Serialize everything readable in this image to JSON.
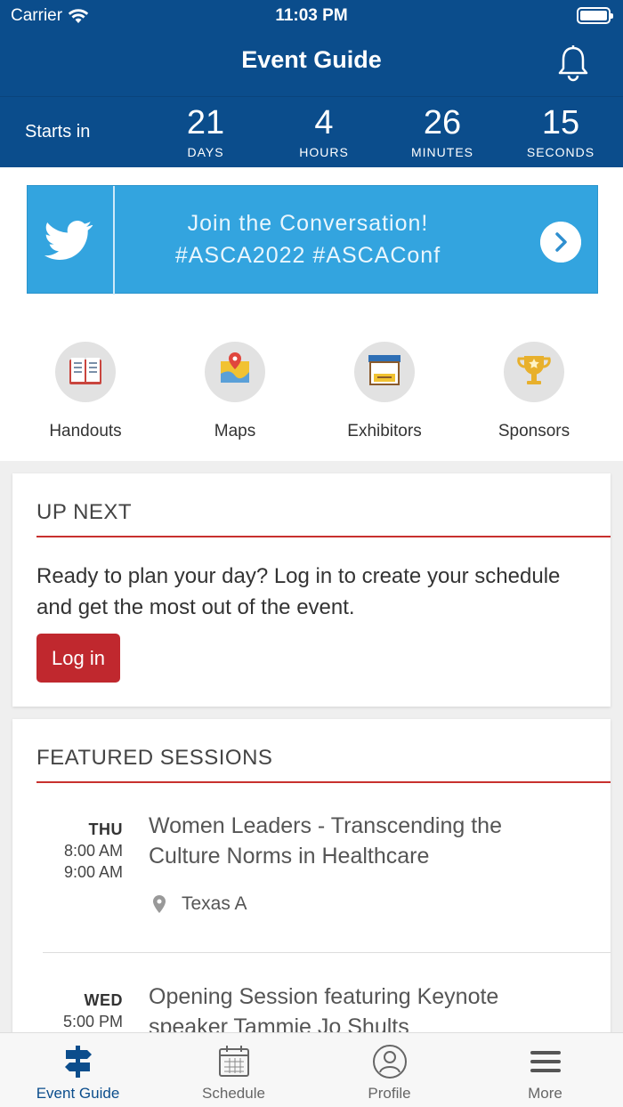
{
  "status": {
    "carrier": "Carrier",
    "time": "11:03 PM"
  },
  "header": {
    "title": "Event Guide"
  },
  "countdown": {
    "label": "Starts in",
    "units": [
      {
        "value": "21",
        "caption": "DAYS"
      },
      {
        "value": "4",
        "caption": "HOURS"
      },
      {
        "value": "26",
        "caption": "MINUTES"
      },
      {
        "value": "15",
        "caption": "SECONDS"
      }
    ]
  },
  "banner": {
    "line1": "Join the Conversation!",
    "line2": "#ASCA2022  #ASCAConf"
  },
  "quick_links": [
    {
      "label": "Handouts",
      "icon": "book-icon"
    },
    {
      "label": "Maps",
      "icon": "map-icon"
    },
    {
      "label": "Exhibitors",
      "icon": "booth-icon"
    },
    {
      "label": "Sponsors",
      "icon": "trophy-icon"
    }
  ],
  "up_next": {
    "heading": "UP NEXT",
    "message": "Ready to plan your day? Log in to create your schedule and get the most out of the event.",
    "login_label": "Log in"
  },
  "featured": {
    "heading": "FEATURED SESSIONS",
    "sessions": [
      {
        "day": "THU",
        "start": "8:00 AM",
        "end": "9:00 AM",
        "title": "Women Leaders -  Transcending the Culture Norms in Healthcare",
        "location": "Texas A"
      },
      {
        "day": "WED",
        "start": "5:00 PM",
        "end": "",
        "title": "Opening Session featuring Keynote speaker Tammie Jo Shults",
        "location": ""
      }
    ]
  },
  "tabs": [
    {
      "label": "Event Guide",
      "icon": "signpost-icon",
      "active": true
    },
    {
      "label": "Schedule",
      "icon": "calendar-icon",
      "active": false
    },
    {
      "label": "Profile",
      "icon": "user-icon",
      "active": false
    },
    {
      "label": "More",
      "icon": "menu-icon",
      "active": false
    }
  ],
  "colors": {
    "primary": "#0b4d8c",
    "twitter": "#33a4df",
    "accent": "#c0282e"
  }
}
